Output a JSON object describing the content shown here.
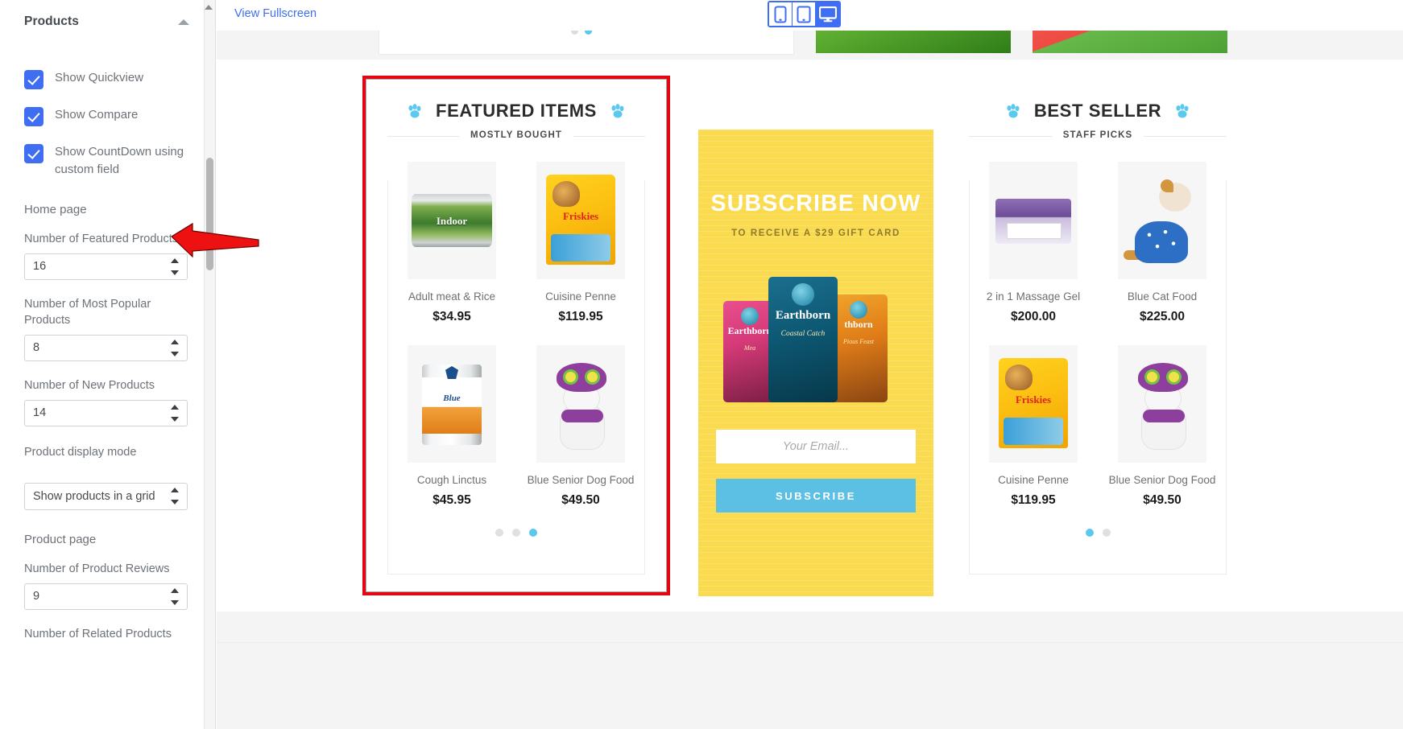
{
  "sidebar": {
    "section_title": "Products",
    "collapse_icon": "caret-up-icon",
    "checkboxes": [
      {
        "label": "Show Quickview",
        "checked": true
      },
      {
        "label": "Show Compare",
        "checked": true
      },
      {
        "label": "Show CountDown using custom field",
        "checked": true
      }
    ],
    "groups": [
      {
        "title": "Home page"
      },
      {
        "title": "Product page"
      }
    ],
    "fields": [
      {
        "label": "Number of Featured Products",
        "value": "16",
        "type": "number"
      },
      {
        "label": "Number of Most Popular Products",
        "value": "8",
        "type": "number"
      },
      {
        "label": "Number of New Products",
        "value": "14",
        "type": "number"
      },
      {
        "label": "Product display mode",
        "value": "Show products in a grid",
        "type": "select"
      },
      {
        "label": "Number of Product Reviews",
        "value": "9",
        "type": "number"
      },
      {
        "label": "Number of Related Products",
        "value": "",
        "type": "number"
      }
    ]
  },
  "topbar": {
    "fullscreen_label": "View Fullscreen",
    "devices": [
      {
        "name": "mobile",
        "active": false
      },
      {
        "name": "tablet",
        "active": false
      },
      {
        "name": "desktop",
        "active": true
      }
    ]
  },
  "featured": {
    "title": "FEATURED ITEMS",
    "subtitle": "MOSTLY BOUGHT",
    "products": [
      {
        "name": "Adult meat & Rice",
        "price": "$34.95"
      },
      {
        "name": "Cuisine Penne",
        "price": "$119.95"
      },
      {
        "name": "Cough Linctus",
        "price": "$45.95"
      },
      {
        "name": "Blue Senior Dog Food",
        "price": "$49.50"
      }
    ],
    "dots": [
      false,
      false,
      true
    ]
  },
  "subscribe": {
    "title": "SUBSCRIBE NOW",
    "caption": "TO RECEIVE A $29 GIFT CARD",
    "email_placeholder": "Your Email...",
    "email_value": "",
    "button_label": "SUBSCRIBE",
    "bag_labels": [
      "Earthborn",
      "Earthborn",
      "thborn"
    ],
    "bag_sublabels": [
      "Mea",
      "Coastal Catch",
      "Pious Feast"
    ]
  },
  "bestseller": {
    "title": "BEST SELLER",
    "subtitle": "STAFF PICKS",
    "products": [
      {
        "name": "2 in 1 Massage Gel",
        "price": "$200.00"
      },
      {
        "name": "Blue Cat Food",
        "price": "$225.00"
      },
      {
        "name": "Cuisine Penne",
        "price": "$119.95"
      },
      {
        "name": "Blue Senior Dog Food",
        "price": "$49.50"
      }
    ],
    "dots": [
      true,
      false
    ]
  },
  "colors": {
    "accent_blue": "#3f6ef3",
    "paw_blue": "#5bc8f0",
    "subscribe_yellow": "#fada4e",
    "subscribe_button": "#5bc0e4",
    "annotation_red": "#e30613"
  }
}
